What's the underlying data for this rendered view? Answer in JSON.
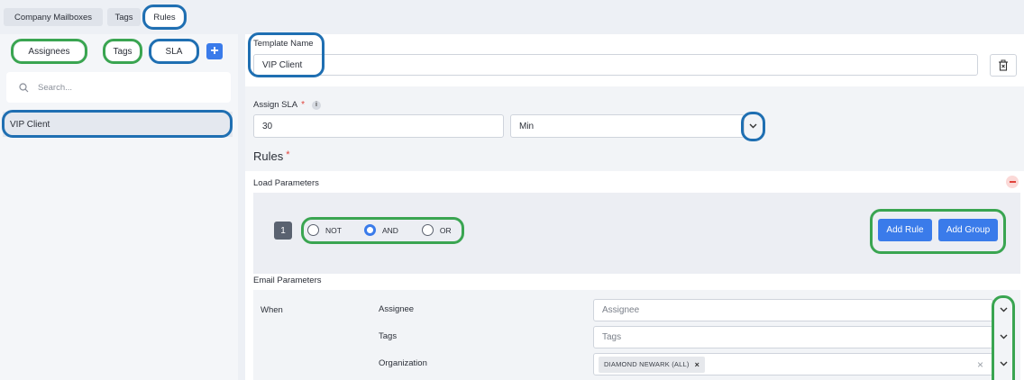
{
  "top_tabs": [
    "Company Mailboxes",
    "Tags",
    "Rules"
  ],
  "sidebar": {
    "pills": [
      "Assignees",
      "Tags",
      "SLA"
    ],
    "add_icon": "plus-icon",
    "search_placeholder": "Search...",
    "items": [
      "VIP Client"
    ]
  },
  "form": {
    "template_name_label": "Template Name",
    "template_name_value": "VIP Client",
    "delete_icon": "trash-icon",
    "assign_sla_label": "Assign SLA",
    "required_mark": "*",
    "sla_value": "30",
    "sla_unit": "Min",
    "rules_heading": "Rules",
    "load_parameters_label": "Load Parameters",
    "group_number": "1",
    "radio_options": [
      "NOT",
      "AND",
      "OR"
    ],
    "radio_selected": "AND",
    "add_rule_label": "Add Rule",
    "add_group_label": "Add Group",
    "email_parameters_label": "Email Parameters",
    "when_label": "When",
    "conditions": [
      {
        "label": "Assignee",
        "placeholder": "Assignee"
      },
      {
        "label": "Tags",
        "placeholder": "Tags"
      },
      {
        "label": "Organization",
        "chip": "DIAMOND NEWARK (ALL)"
      }
    ]
  },
  "colors": {
    "accent": "#3a7bea",
    "annotation_blue": "#1f6fb2",
    "annotation_green": "#3aa551",
    "danger": "#e0443c"
  }
}
